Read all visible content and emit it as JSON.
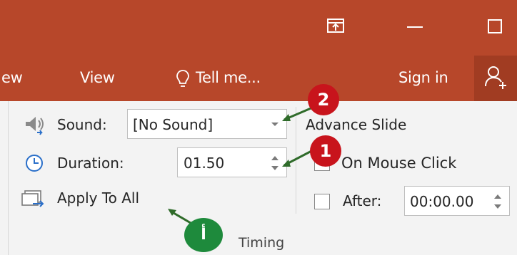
{
  "tabs": {
    "partial_tab": "ew",
    "view": "View",
    "tell_me": "Tell me...",
    "sign_in": "Sign in"
  },
  "sound": {
    "label": "Sound:",
    "value": "[No Sound]"
  },
  "duration": {
    "label": "Duration:",
    "value": "01.50"
  },
  "apply_all": {
    "label": "Apply To All"
  },
  "advance": {
    "heading": "Advance Slide",
    "on_mouse_click": "On Mouse Click",
    "on_mouse_click_checked": false,
    "after_label": "After:",
    "after_checked": false,
    "after_value": "00:00.00"
  },
  "group_label": "Timing",
  "annotations": {
    "badge_1": "1",
    "badge_2": "2",
    "badge_a": "أ"
  },
  "colors": {
    "accent": "#b7472a",
    "badge_red": "#c8141c",
    "badge_green": "#1e8a3c",
    "ribbon": "#f3f3f3"
  }
}
